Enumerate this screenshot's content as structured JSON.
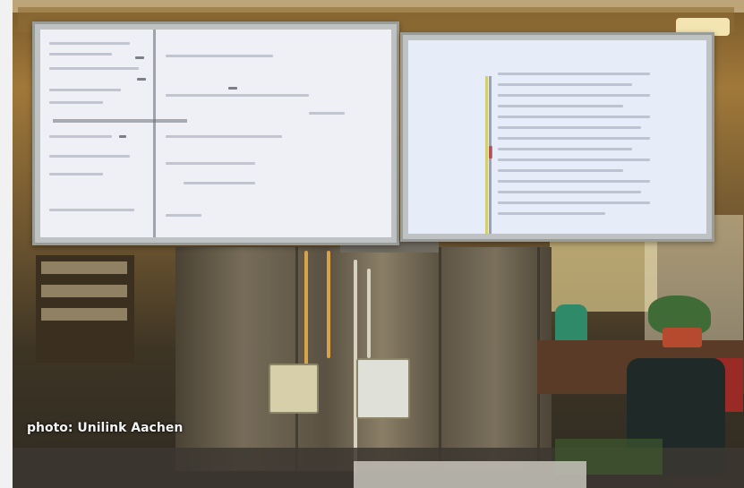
{
  "photo": {
    "credit": "photo: Unilink Aachen",
    "subject": "Two wall-mounted monitors above a metal cabinet in an office"
  },
  "colors": {
    "screen": "#eef0f6",
    "screen_right": "#e6ecf8",
    "bezel": "#bfc2c2",
    "wall": "#a0783a",
    "cabinet": "#766c58"
  },
  "icons": []
}
